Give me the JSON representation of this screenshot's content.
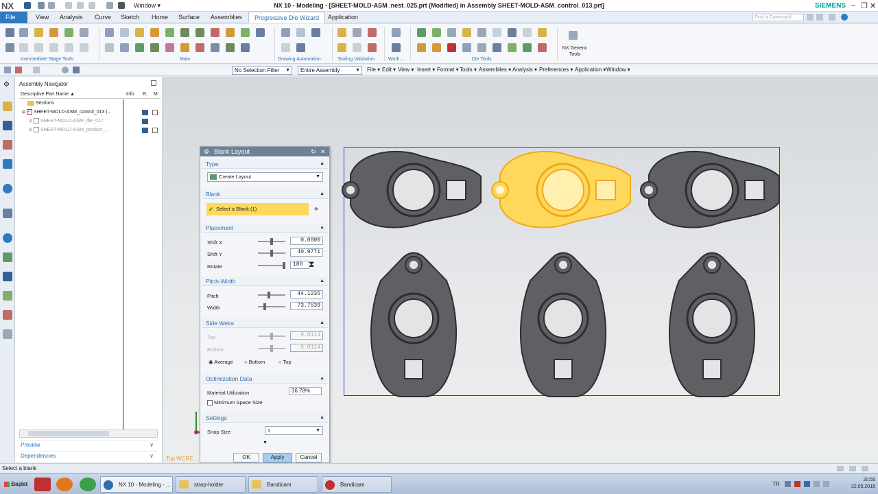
{
  "app": {
    "logo": "NX",
    "window_menu": "Window",
    "title": "NX 10 - Modeling - [SHEET-MOLD-ASM_nest_025.prt (Modified)  in Assembly SHEET-MOLD-ASM_control_013.prt]",
    "brand": "SIEMENS",
    "find_placeholder": "Find a Command"
  },
  "menu_tabs": [
    "File",
    "View",
    "Analysis",
    "Curve",
    "Sketch",
    "Home",
    "Surface",
    "Assemblies",
    "Progressive Die Wizard",
    "Application"
  ],
  "ribbon": {
    "groups": [
      "Intermediate Stage Tools",
      "Main",
      "Drawing Automation",
      "Tooling Validation",
      "Work...",
      "Die Tools",
      "NX Generic Tools"
    ]
  },
  "selection_bar": {
    "filter": "No Selection Filter",
    "scope": "Entire Assembly",
    "menus": [
      "File",
      "Edit",
      "View",
      "Insert",
      "Format",
      "Tools",
      "Assemblies",
      "Analysis",
      "Preferences",
      "Application",
      "Window"
    ]
  },
  "navigator": {
    "title": "Assembly Navigator",
    "columns": [
      "Descriptive Part Name",
      "Info",
      "R..",
      "M"
    ],
    "rows": [
      {
        "label": "Sections",
        "greyed": false
      },
      {
        "label": "SHEET-MOLD-ASM_control_013 (...",
        "greyed": false
      },
      {
        "label": "SHEET-MOLD-ASM_die_017",
        "greyed": true
      },
      {
        "label": "SHEET-MOLD-ASM_product_...",
        "greyed": true
      }
    ],
    "footer": [
      "Preview",
      "Dependencies"
    ]
  },
  "dialog": {
    "title": "Blank Layout",
    "type_section": "Type",
    "type_value": "Create Layout",
    "blank_section": "Blank",
    "blank_select": "Select a Blank (1)",
    "placement_section": "Placement",
    "shift_x_label": "Shift X",
    "shift_x": "0.0000",
    "shift_y_label": "Shift Y",
    "shift_y": "40.9771",
    "rotate_label": "Rotate",
    "rotate": "180",
    "pitch_section": "Pitch-Width",
    "pitch_label": "Pitch",
    "pitch": "44.1235",
    "width_label": "Width",
    "width": "73.7539",
    "side_webs_section": "Side Webs",
    "top_label": "Top",
    "top_value": "0.0114",
    "bottom_label": "Bottom",
    "bottom_value": "0.0114",
    "radio_options": [
      "Average",
      "Bottom",
      "Top"
    ],
    "optimization_section": "Optimization Data",
    "material_label": "Material Utilization",
    "material_value": "36.78%",
    "min_space_label": "Minimum Space Size",
    "settings_section": "Settings",
    "snap_label": "Snap Size",
    "snap_value": "1",
    "ok": "OK",
    "apply": "Apply",
    "cancel": "Cancel"
  },
  "graphics": {
    "watermark": "Top WCRE..."
  },
  "status": {
    "text": "Select a blank"
  },
  "taskbar": {
    "start": "Başlat",
    "items": [
      "NX 10 - Modeling - ...",
      "strap-holder",
      "Bandicam",
      "Bandicam"
    ],
    "lang": "TR",
    "time": "20:55",
    "date": "22.05.2016"
  },
  "colors": {
    "accent": "#2f7bc2",
    "selection_yellow": "#fdd85a",
    "part_grey": "#5f6063",
    "frame_blue": "#3333dd"
  }
}
